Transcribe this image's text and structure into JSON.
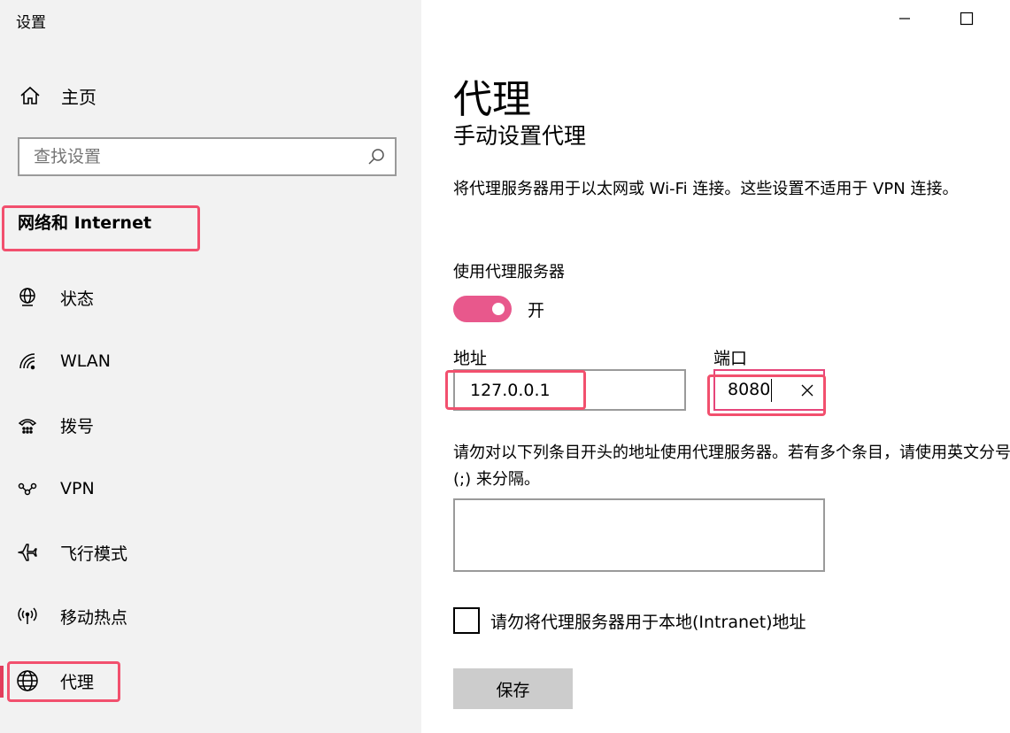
{
  "window": {
    "title": "设置",
    "minimize_icon": "minimize-icon",
    "maximize_icon": "maximize-icon"
  },
  "sidebar": {
    "home_label": "主页",
    "home_icon": "home-icon",
    "search_placeholder": "查找设置",
    "search_icon": "search-icon",
    "section_title": "网络和 Internet",
    "items": [
      {
        "label": "状态",
        "icon": "status-globe-icon"
      },
      {
        "label": "WLAN",
        "icon": "wifi-icon"
      },
      {
        "label": "拨号",
        "icon": "dialup-phone-icon"
      },
      {
        "label": "VPN",
        "icon": "vpn-icon"
      },
      {
        "label": "飞行模式",
        "icon": "airplane-icon"
      },
      {
        "label": "移动热点",
        "icon": "hotspot-icon"
      },
      {
        "label": "代理",
        "icon": "globe-icon",
        "selected": true
      }
    ]
  },
  "main": {
    "title": "代理",
    "subtitle": "手动设置代理",
    "description": "将代理服务器用于以太网或 Wi-Fi 连接。这些设置不适用于 VPN 连接。",
    "use_proxy_label": "使用代理服务器",
    "toggle_state": "开",
    "toggle_on": true,
    "address_label": "地址",
    "address_value": "127.0.0.1",
    "port_label": "端口",
    "port_value": "8080",
    "exceptions_description": "请勿对以下列条目开头的地址使用代理服务器。若有多个条目，请使用英文分号 (;) 来分隔。",
    "exceptions_value": "",
    "local_checkbox_label": "请勿将代理服务器用于本地(Intranet)地址",
    "local_checkbox_checked": false,
    "save_label": "保存"
  },
  "colors": {
    "accent": "#e8588c",
    "highlight": "#f2506e",
    "sidebar_bg": "#f2f2f2",
    "button_bg": "#cccccc"
  }
}
